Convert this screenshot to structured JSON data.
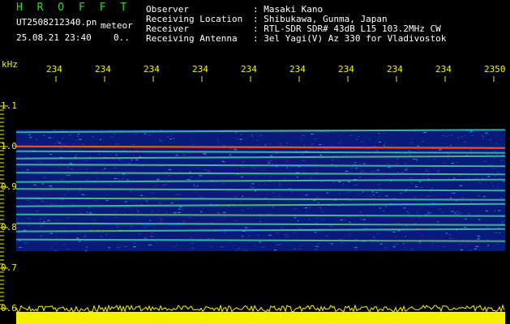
{
  "header": {
    "logo": "H R O F F T",
    "file_name": "UT2508212340.pn",
    "mode": "meteor",
    "date_time": "25.08.21 23:40",
    "counter": "0.."
  },
  "station": {
    "labels": [
      "Observer",
      "Receiving Location",
      "Receiver",
      "Receiving Antenna"
    ],
    "values": [
      ": Masaki Kano",
      ": Shibukawa, Gunma, Japan",
      ": RTL-SDR SDR# 43dB L15 103.2MHz CW",
      ": 3el Yagi(V) Az 330 for Vladivostok"
    ]
  },
  "axes": {
    "y_unit": "kHz",
    "y_ticks": [
      "1.1",
      "1.0",
      "0.9",
      "0.8",
      "0.7",
      "0.6"
    ],
    "x_ticks": [
      "234",
      "234",
      "234",
      "234",
      "234",
      "234",
      "234",
      "234",
      "234",
      "2350"
    ]
  },
  "colors": {
    "background": "#000000",
    "logo": "#22e01c",
    "labels": "#ffffff",
    "ticks": "#f2f200",
    "noise_bar": "#f5f000",
    "spectrum_base": "#0a1a78"
  },
  "spectrum": {
    "echo_lines_khz": [
      1.035,
      1.0,
      0.988,
      0.97,
      0.955,
      0.935,
      0.912,
      0.895,
      0.872,
      0.852,
      0.832,
      0.81,
      0.79,
      0.77
    ]
  }
}
